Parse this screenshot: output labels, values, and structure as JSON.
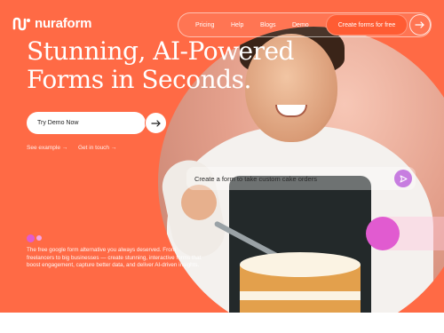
{
  "brand": {
    "name": "nuraform"
  },
  "nav": {
    "links": [
      "Pricing",
      "Help",
      "Blogs",
      "Demo"
    ],
    "cta_label": "Create forms for free",
    "arrow_icon": "arrow-right-icon"
  },
  "hero": {
    "headline_line1": "Stunning, AI-Powered",
    "headline_line2": "Forms in Seconds.",
    "demo_label": "Try Demo Now",
    "see_example": "See example →",
    "get_in_touch": "Get in touch →",
    "prompt_text": "Create a form to take custom cake orders",
    "send_icon": "send-icon",
    "blurb": "The free google form alternative you always deserved. From freelancers to big businesses — create stunning, interactive forms that boost engagement, capture better data, and deliver AI-driven insights."
  },
  "colors": {
    "background": "#ff6a45",
    "accent_pink": "#e15bd0",
    "send_button": "#c77de0",
    "text": "#ffffff"
  }
}
